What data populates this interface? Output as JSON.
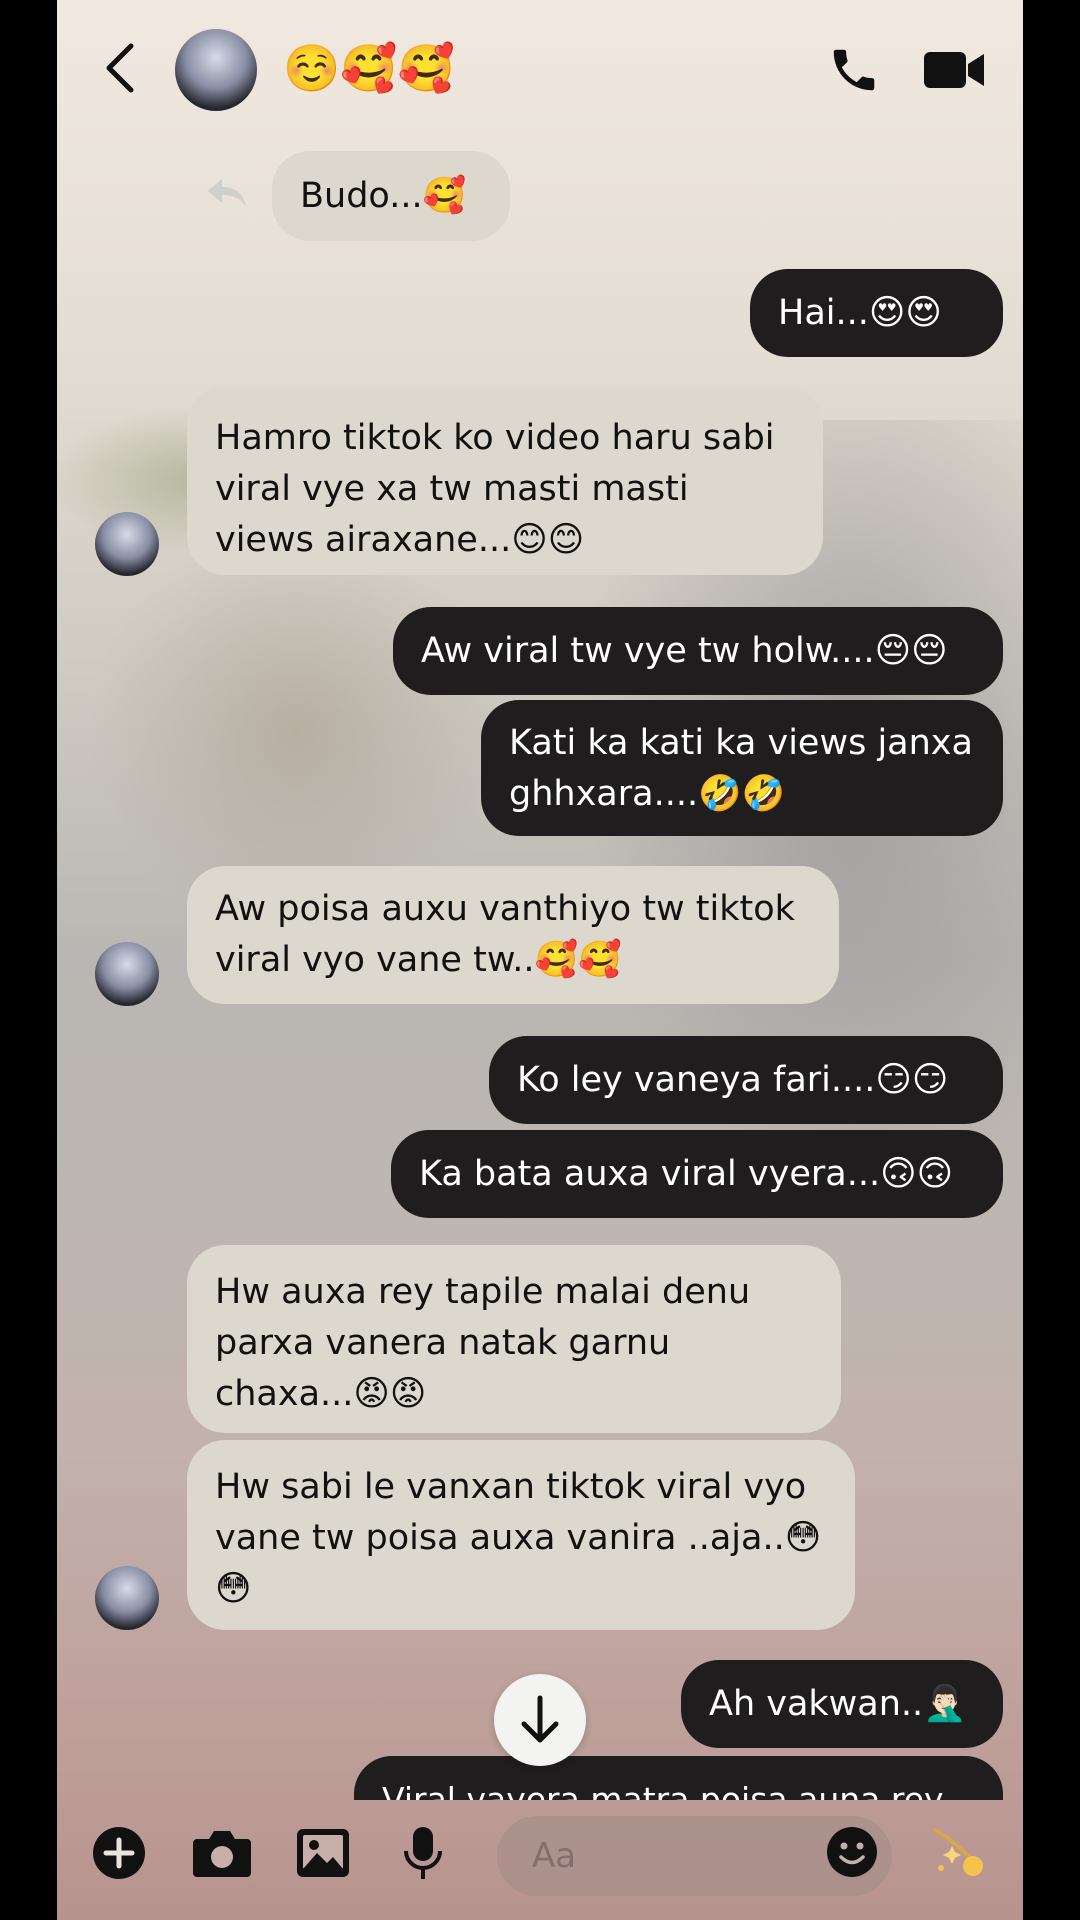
{
  "header": {
    "contact_name": "☺️🥰🥰",
    "back_icon": "chevron-left-icon",
    "call_icon": "phone-icon",
    "video_icon": "video-camera-icon"
  },
  "messages": [
    {
      "side": "in",
      "text": "Budo...🥰",
      "replied": true
    },
    {
      "side": "out",
      "text": "Hai...😍😍"
    },
    {
      "side": "in",
      "text": "Hamro tiktok ko video haru sabi viral vye xa tw masti masti views airaxane...😊😊"
    },
    {
      "side": "out",
      "text": "Aw viral tw vye tw holw....😔😔"
    },
    {
      "side": "out",
      "text": "Kati ka kati ka views janxa ghhxara....🤣🤣"
    },
    {
      "side": "in",
      "text": "Aw poisa auxu vanthiyo tw tiktok viral vyo vane tw..🥰🥰"
    },
    {
      "side": "out",
      "text": "Ko ley vaneya fari....😏😏"
    },
    {
      "side": "out",
      "text": "Ka bata auxa viral vyera...🙃🙃"
    },
    {
      "side": "in",
      "text": "Hw auxa rey tapile malai denu parxa vanera natak garnu chaxa...😡😡"
    },
    {
      "side": "in",
      "text": "Hw sabi le vanxan tiktok viral vyo vane tw poisa auxa vanira ..aja..😳😳"
    },
    {
      "side": "out",
      "text": "Ah vakwan..🤦🏻‍♂️"
    },
    {
      "side": "out",
      "text": "Viral vayera matra poisa auna rey"
    }
  ],
  "composer": {
    "placeholder": "Aa",
    "tools": [
      "plus-icon",
      "camera-icon",
      "gallery-icon",
      "microphone-icon",
      "sticker-smile-icon",
      "sparkle-comet-icon"
    ]
  },
  "colors": {
    "incoming_bubble": "#dcd8cd",
    "outgoing_bubble": "#1f1d1d",
    "header_bg": "#f1e9df"
  }
}
